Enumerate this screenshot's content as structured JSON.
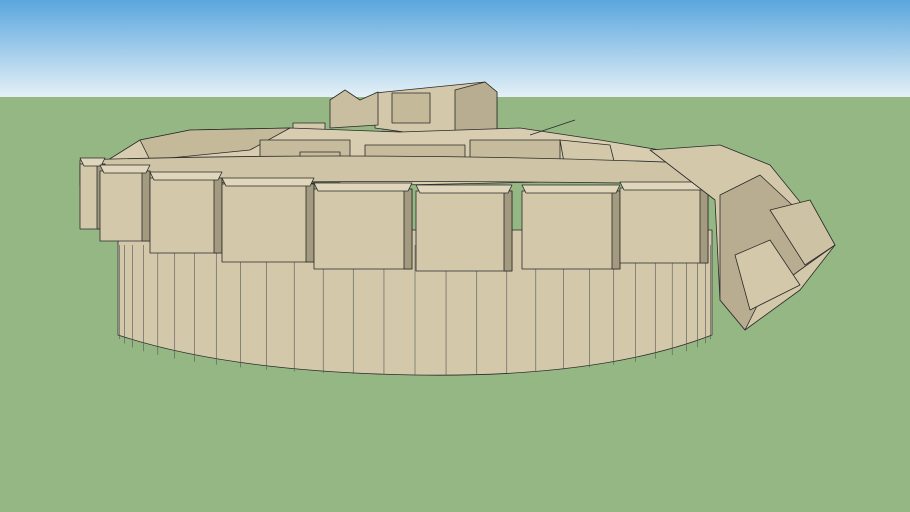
{
  "scene": {
    "colors": {
      "sky_top": "#5aa6de",
      "sky_horizon": "#e6f1f6",
      "ground": "#95b784",
      "model_face": "#d3c8aa",
      "model_shadow": "#b8ad90",
      "model_dark": "#a39a80",
      "edge": "#2a2a2a"
    }
  }
}
